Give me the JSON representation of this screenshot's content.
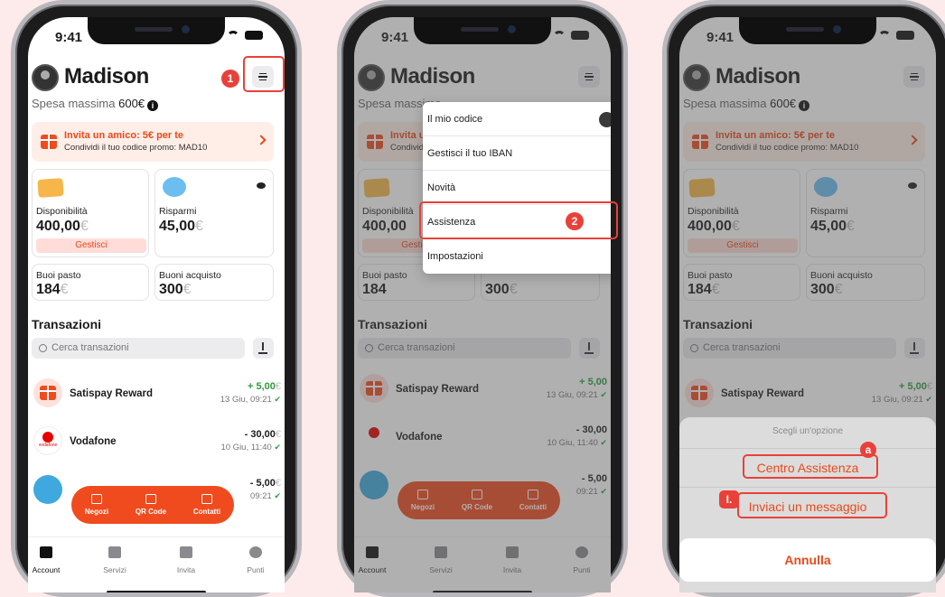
{
  "status": {
    "time": "9:41"
  },
  "user": {
    "name": "Madison",
    "spending_label": "Spesa massima",
    "spending_value": "600€",
    "info": "i"
  },
  "promo": {
    "title": "Invita un amico: 5€ per te",
    "subtitle": "Condividi il tuo codice promo: MAD10"
  },
  "cards": {
    "disponibilita": {
      "label": "Disponibilità",
      "value": "400,00",
      "currency": "€",
      "button": "Gestisci"
    },
    "risparmi": {
      "label": "Risparmi",
      "value": "45,00",
      "currency": "€"
    },
    "buoni_pasto": {
      "label": "Buoi pasto",
      "value": "184",
      "currency": "€"
    },
    "buoni_acquisto": {
      "label": "Buoni acquisto",
      "value": "300",
      "currency": "€"
    }
  },
  "transactions": {
    "title": "Transazioni",
    "search_placeholder": "Cerca transazioni",
    "items": [
      {
        "name": "Satispay Reward",
        "amount": "+ 5,00",
        "currency": "€",
        "date": "13 Giu, 09:21"
      },
      {
        "name": "Vodafone",
        "amount": "- 30,00",
        "currency": "€",
        "date": "10 Giu, 11:40"
      },
      {
        "name": "",
        "amount": "- 5,00",
        "currency": "€",
        "date": "09:21"
      }
    ]
  },
  "vodafone_logo_text": "vodafone",
  "fab": {
    "items": [
      {
        "label": "Negozi",
        "icon": "bag-icon"
      },
      {
        "label": "QR Code",
        "icon": "qr-icon"
      },
      {
        "label": "Contatti",
        "icon": "contacts-icon"
      }
    ]
  },
  "tabbar": {
    "items": [
      {
        "label": "Account",
        "icon": "wallet-icon"
      },
      {
        "label": "Servizi",
        "icon": "grid-icon"
      },
      {
        "label": "Invita",
        "icon": "megaphone-icon"
      },
      {
        "label": "Punti",
        "icon": "bolt-icon"
      }
    ]
  },
  "dropdown": {
    "items": [
      "Il mio codice",
      "Gestisci il tuo IBAN",
      "Novità",
      "Assistenza",
      "Impostazioni"
    ]
  },
  "action_sheet": {
    "title": "Scegli un'opzione",
    "options": [
      "Centro Assistenza",
      "Inviaci un messaggio"
    ],
    "cancel": "Annulla"
  },
  "step_badges": {
    "step1": "1",
    "step2": "2",
    "step_a": "a",
    "step_b": "I."
  },
  "colors": {
    "accent": "#f04b1f",
    "highlight": "#e8413a",
    "background": "#fdeaea"
  }
}
